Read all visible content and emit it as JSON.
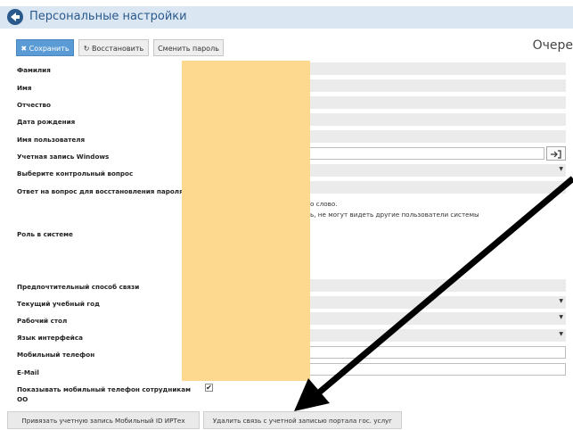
{
  "header": {
    "title": "Персональные настройки"
  },
  "toolbar": {
    "save": "Сохранить",
    "restore": "Восстановить",
    "change_password": "Сменить пароль"
  },
  "queue_label": "Очере",
  "fields": {
    "surname": "Фамилия",
    "name": "Имя",
    "patronymic": "Отчество",
    "birthdate": "Дата рождения",
    "username": "Имя пользователя",
    "windows_account": "Учетная запись Windows",
    "control_question": "Выберите контрольный вопрос",
    "answer": "Ответ на вопрос для восстановления пароля",
    "role": "Роль в системе",
    "contact_method": "Предпочтительный способ связи",
    "school_year": "Текущий учебный год",
    "desktop": "Рабочий стол",
    "language": "Язык интерфейса",
    "mobile": "Мобильный телефон",
    "email": "E-Mail",
    "show_phone_line1": "Показывать мобильный телефон сотрудникам",
    "show_phone_line2": "ОО"
  },
  "notes": {
    "note1": "о слово.",
    "note2": "ь, не могут видеть другие пользователи системы"
  },
  "checkbox": {
    "show_phone_checked": "✔"
  },
  "bottom": {
    "link_mobile_id": "Привязать учетную запись Мобильный ID ИРТех",
    "unlink_gov": "Удалить связь с учетной записью портала гос. услуг"
  },
  "colors": {
    "header_bg": "#dbe6f3",
    "title": "#2a5a8c",
    "primary": "#5b9bd5",
    "overlay": "#fdd88f"
  }
}
